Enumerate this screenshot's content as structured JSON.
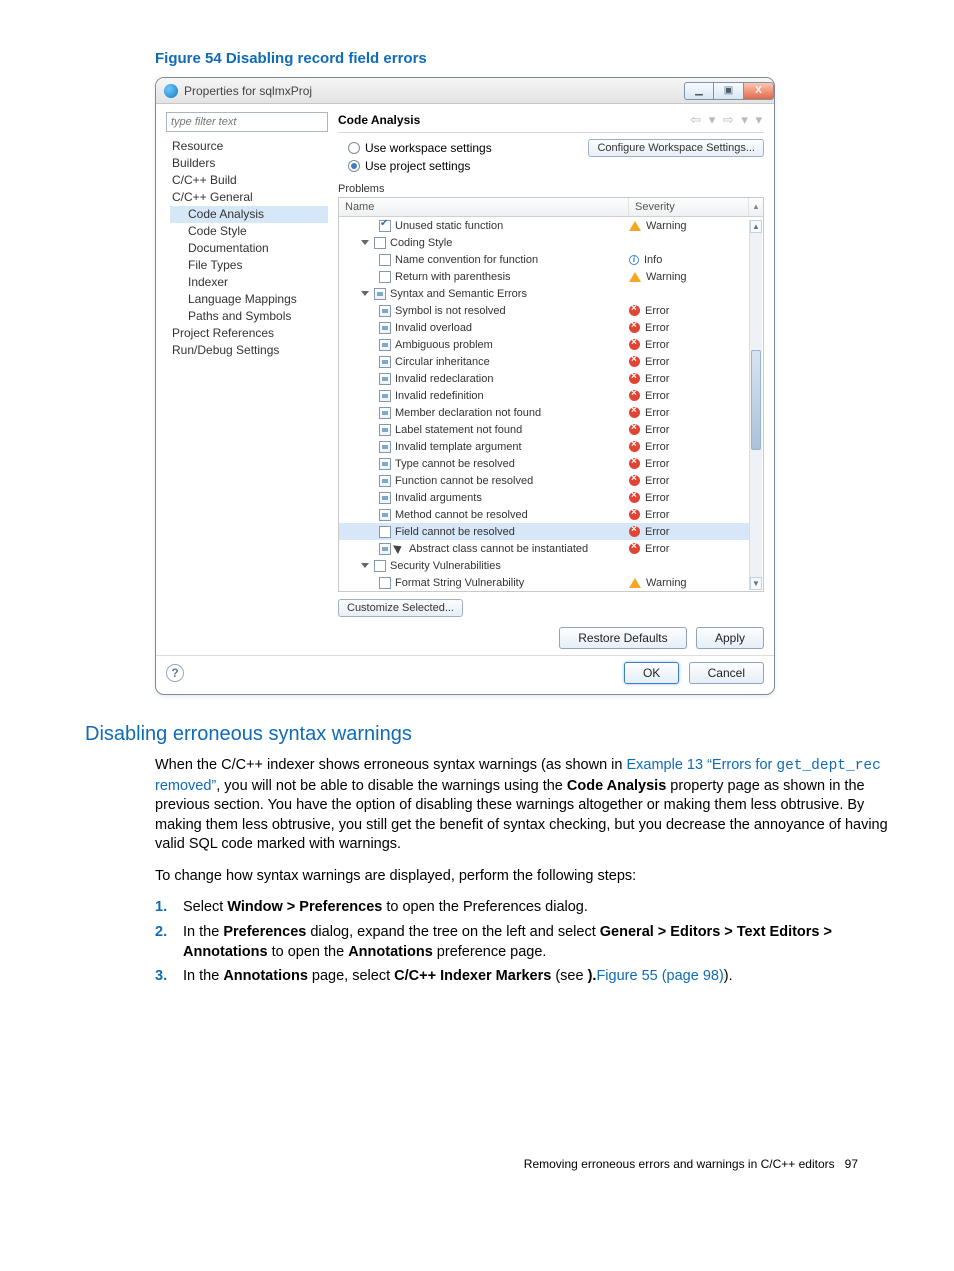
{
  "figure_caption": "Figure 54 Disabling record field errors",
  "dialog": {
    "title": "Properties for sqlmxProj",
    "win": {
      "min": "▁",
      "max": "▣",
      "close": "X"
    },
    "filter_placeholder": "type filter text",
    "tree": [
      {
        "label": "Resource",
        "indent": 0
      },
      {
        "label": "Builders",
        "indent": 0
      },
      {
        "label": "C/C++ Build",
        "indent": 0
      },
      {
        "label": "C/C++ General",
        "indent": 0
      },
      {
        "label": "Code Analysis",
        "indent": 1,
        "selected": true
      },
      {
        "label": "Code Style",
        "indent": 1
      },
      {
        "label": "Documentation",
        "indent": 1
      },
      {
        "label": "File Types",
        "indent": 1
      },
      {
        "label": "Indexer",
        "indent": 1
      },
      {
        "label": "Language Mappings",
        "indent": 1
      },
      {
        "label": "Paths and Symbols",
        "indent": 1
      },
      {
        "label": "Project References",
        "indent": 0
      },
      {
        "label": "Run/Debug Settings",
        "indent": 0
      }
    ],
    "panel_title": "Code Analysis",
    "radio": {
      "workspace": "Use workspace settings",
      "project": "Use project settings"
    },
    "config_link": "Configure Workspace Settings...",
    "problems_label": "Problems",
    "columns": {
      "name": "Name",
      "severity": "Severity"
    },
    "rows": [
      {
        "depth": 2,
        "check": "on",
        "label": "Unused static function",
        "sev": "Warning"
      },
      {
        "depth": 1,
        "expander": true,
        "check": "off",
        "label": "Coding Style"
      },
      {
        "depth": 2,
        "check": "off",
        "label": "Name convention for function",
        "sev": "Info"
      },
      {
        "depth": 2,
        "check": "off",
        "label": "Return with parenthesis",
        "sev": "Warning"
      },
      {
        "depth": 1,
        "expander": true,
        "check": "half",
        "label": "Syntax and Semantic Errors"
      },
      {
        "depth": 2,
        "check": "half",
        "label": "Symbol is not resolved",
        "sev": "Error"
      },
      {
        "depth": 2,
        "check": "half",
        "label": "Invalid overload",
        "sev": "Error"
      },
      {
        "depth": 2,
        "check": "half",
        "label": "Ambiguous problem",
        "sev": "Error"
      },
      {
        "depth": 2,
        "check": "half",
        "label": "Circular inheritance",
        "sev": "Error"
      },
      {
        "depth": 2,
        "check": "half",
        "label": "Invalid redeclaration",
        "sev": "Error"
      },
      {
        "depth": 2,
        "check": "half",
        "label": "Invalid redefinition",
        "sev": "Error"
      },
      {
        "depth": 2,
        "check": "half",
        "label": "Member declaration not found",
        "sev": "Error"
      },
      {
        "depth": 2,
        "check": "half",
        "label": "Label statement not found",
        "sev": "Error"
      },
      {
        "depth": 2,
        "check": "half",
        "label": "Invalid template argument",
        "sev": "Error"
      },
      {
        "depth": 2,
        "check": "half",
        "label": "Type cannot be resolved",
        "sev": "Error"
      },
      {
        "depth": 2,
        "check": "half",
        "label": "Function cannot be resolved",
        "sev": "Error"
      },
      {
        "depth": 2,
        "check": "half",
        "label": "Invalid arguments",
        "sev": "Error"
      },
      {
        "depth": 2,
        "check": "half",
        "label": "Method cannot be resolved",
        "sev": "Error"
      },
      {
        "depth": 2,
        "check": "off",
        "label": "Field cannot be resolved",
        "sev": "Error",
        "selected": true
      },
      {
        "depth": 2,
        "check": "half",
        "label": "Abstract class cannot be instantiated",
        "sev": "Error",
        "cursor": true
      },
      {
        "depth": 1,
        "expander": true,
        "check": "off",
        "label": "Security Vulnerabilities"
      },
      {
        "depth": 2,
        "check": "off",
        "label": "Format String Vulnerability",
        "sev": "Warning"
      }
    ],
    "customize_btn": "Customize Selected...",
    "restore_btn": "Restore Defaults",
    "apply_btn": "Apply",
    "help": "?",
    "ok_btn": "OK",
    "cancel_btn": "Cancel"
  },
  "section": {
    "title": "Disabling erroneous syntax warnings",
    "p1_a": "When the C/C++ indexer shows erroneous syntax warnings (as shown in ",
    "p1_link": "Example 13 “Errors for",
    "p1_code": "get_dept_rec",
    "p1_link2": " removed”",
    "p1_b": ", you will not be able to disable the warnings using the ",
    "p1_bold": "Code Analysis",
    "p1_c": " property page as shown in the previous section. You have the option of disabling these warnings altogether or making them less obtrusive. By making them less obtrusive, you still get the benefit of syntax checking, but you decrease the annoyance of having valid SQL code marked with warnings.",
    "p2": "To change how syntax warnings are displayed, perform the following steps:",
    "steps": [
      {
        "n": "1.",
        "a": "Select ",
        "b": "Window > Preferences",
        "c": " to open the Preferences dialog."
      },
      {
        "n": "2.",
        "a": "In the ",
        "b": "Preferences",
        "c": " dialog, expand the tree on the left and select ",
        "d": "General > Editors > Text Editors > Annotations",
        "e": " to open the ",
        "f": "Annotations",
        "g": " preference page."
      },
      {
        "n": "3.",
        "a": "In the ",
        "b": "Annotations",
        "c": " page, select ",
        "d": "C/C++ Indexer Markers",
        "e": " (see ",
        "link": "Figure 55 (page 98)",
        "f": ")."
      }
    ]
  },
  "footer": {
    "text": "Removing erroneous errors and warnings in C/C++ editors",
    "page": "97"
  }
}
